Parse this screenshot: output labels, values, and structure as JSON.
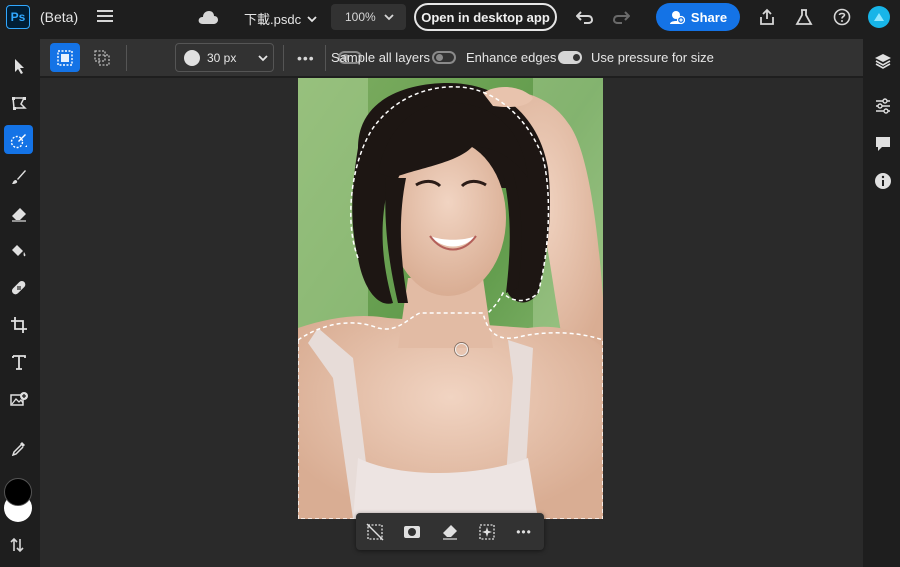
{
  "app": {
    "logo": "Ps",
    "beta_label": "(Beta)",
    "filename": "下載.psdc",
    "zoom": "100%",
    "open_desktop": "Open in desktop app",
    "share": "Share"
  },
  "options": {
    "brush_size": "30 px",
    "sample_all_layers": "Sample all layers",
    "sample_all_layers_on": false,
    "enhance_edges": "Enhance edges",
    "enhance_edges_on": false,
    "use_pressure": "Use pressure for size",
    "use_pressure_on": true
  },
  "tools": [
    "move-tool",
    "lasso-tool",
    "quick-selection-tool",
    "brush-tool",
    "eraser-tool",
    "paint-bucket-tool",
    "healing-tool",
    "crop-tool",
    "type-tool",
    "add-image-tool",
    "eyedropper-tool"
  ],
  "colors": {
    "accent": "#1473e6",
    "foreground": "#000000",
    "background": "#ffffff"
  }
}
